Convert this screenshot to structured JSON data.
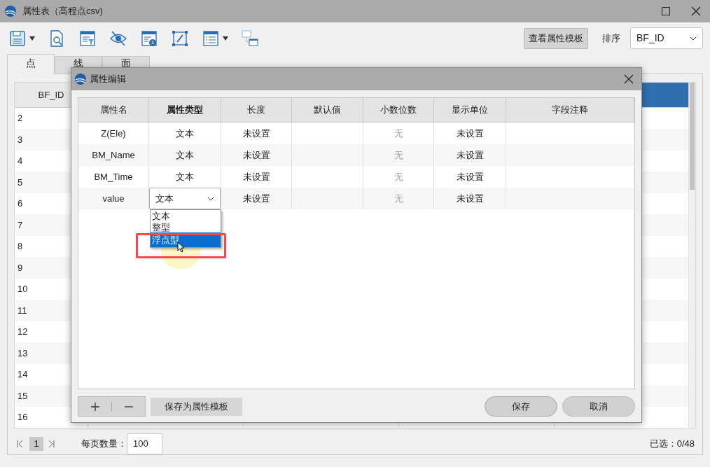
{
  "window": {
    "title": "属性表（高程点csv)"
  },
  "toolbar": {
    "view_template_button": "查看属性模板",
    "sort_label": "排序",
    "sort_value": "BF_ID"
  },
  "tabs": [
    {
      "label": "点",
      "selected": true
    },
    {
      "label": "线",
      "selected": false
    },
    {
      "label": "面",
      "selected": false
    }
  ],
  "table": {
    "columns": [
      {
        "label": "BF_ID",
        "selected": false
      },
      {
        "selected": true
      }
    ],
    "rows": [
      "2",
      "3",
      "4",
      "5",
      "6",
      "7",
      "8",
      "9",
      "10",
      "11",
      "12",
      "13",
      "14",
      "15",
      "16"
    ]
  },
  "pagination": {
    "page": "1",
    "per_page_label": "每页数量：",
    "per_page_value": "100",
    "selected_count": "已选：0/48"
  },
  "dialog": {
    "title": "属性编辑",
    "columns": [
      "属性名",
      "属性类型",
      "长度",
      "默认值",
      "小数位数",
      "显示单位",
      "字段注释"
    ],
    "rows": [
      {
        "name": "Z(Ele)",
        "type": "文本",
        "length": "未设置",
        "decimals": "无",
        "unit": "未设置",
        "editing": false
      },
      {
        "name": "BM_Name",
        "type": "文本",
        "length": "未设置",
        "decimals": "无",
        "unit": "未设置",
        "editing": false
      },
      {
        "name": "BM_Time",
        "type": "文本",
        "length": "未设置",
        "decimals": "无",
        "unit": "未设置",
        "editing": false
      },
      {
        "name": "value",
        "type": "文本",
        "length": "未设置",
        "decimals": "无",
        "unit": "未设置",
        "editing": true
      }
    ],
    "type_options": [
      {
        "label": "文本",
        "selected": false
      },
      {
        "label": "整型",
        "selected": false
      },
      {
        "label": "浮点型",
        "selected": true
      }
    ],
    "save_template_button": "保存为属性模板",
    "save_button": "保存",
    "cancel_button": "取消"
  }
}
